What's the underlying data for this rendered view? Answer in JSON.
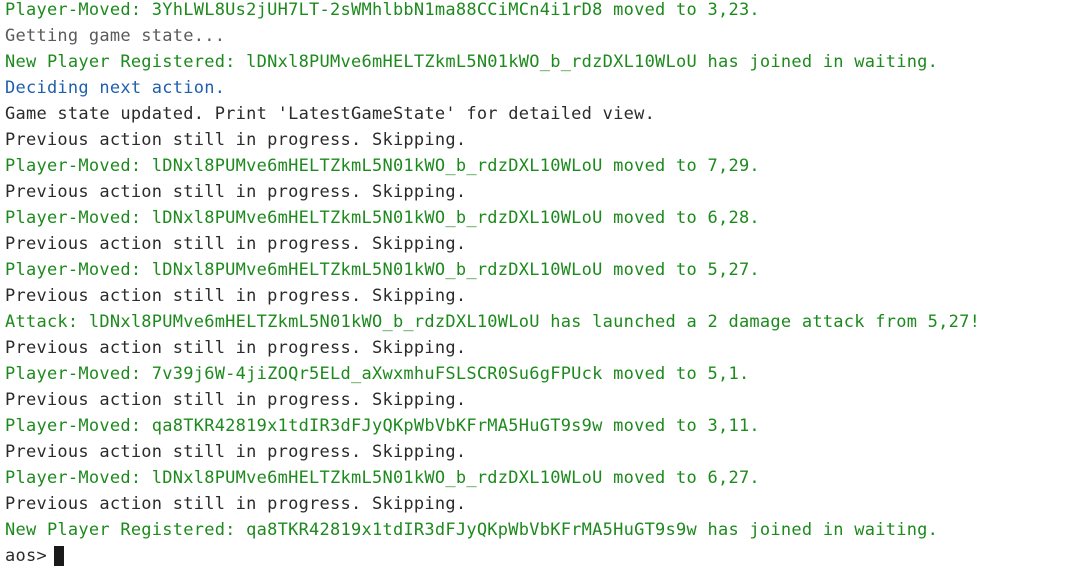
{
  "terminal": {
    "lines": [
      {
        "text": "Player-Moved: 3YhLWL8Us2jUH7LT-2sWMhlbbN1ma88CCiMCn4i1rD8 moved to 3,23.",
        "color": "#1d8a1d"
      },
      {
        "text": "Getting game state...",
        "color": "#5a5a5a"
      },
      {
        "text": "New Player Registered: lDNxl8PUMve6mHELTZkmL5N01kWO_b_rdzDXL10WLoU has joined in waiting.",
        "color": "#1d8a1d"
      },
      {
        "text": "Deciding next action.",
        "color": "#1f5fae"
      },
      {
        "text": "Game state updated. Print 'LatestGameState' for detailed view.",
        "color": "#2b2b2b"
      },
      {
        "text": "Previous action still in progress. Skipping.",
        "color": "#2b2b2b"
      },
      {
        "text": "Player-Moved: lDNxl8PUMve6mHELTZkmL5N01kWO_b_rdzDXL10WLoU moved to 7,29.",
        "color": "#1d8a1d"
      },
      {
        "text": "Previous action still in progress. Skipping.",
        "color": "#2b2b2b"
      },
      {
        "text": "Player-Moved: lDNxl8PUMve6mHELTZkmL5N01kWO_b_rdzDXL10WLoU moved to 6,28.",
        "color": "#1d8a1d"
      },
      {
        "text": "Previous action still in progress. Skipping.",
        "color": "#2b2b2b"
      },
      {
        "text": "Player-Moved: lDNxl8PUMve6mHELTZkmL5N01kWO_b_rdzDXL10WLoU moved to 5,27.",
        "color": "#1d8a1d"
      },
      {
        "text": "Previous action still in progress. Skipping.",
        "color": "#2b2b2b"
      },
      {
        "text": "Attack: lDNxl8PUMve6mHELTZkmL5N01kWO_b_rdzDXL10WLoU has launched a 2 damage attack from 5,27!",
        "color": "#1d8a1d"
      },
      {
        "text": "Previous action still in progress. Skipping.",
        "color": "#2b2b2b"
      },
      {
        "text": "Player-Moved: 7v39j6W-4jiZOQr5ELd_aXwxmhuFSLSCR0Su6gFPUck moved to 5,1.",
        "color": "#1d8a1d"
      },
      {
        "text": "Previous action still in progress. Skipping.",
        "color": "#2b2b2b"
      },
      {
        "text": "Player-Moved: qa8TKR42819x1tdIR3dFJyQKpWbVbKFrMA5HuGT9s9w moved to 3,11.",
        "color": "#1d8a1d"
      },
      {
        "text": "Previous action still in progress. Skipping.",
        "color": "#2b2b2b"
      },
      {
        "text": "Player-Moved: lDNxl8PUMve6mHELTZkmL5N01kWO_b_rdzDXL10WLoU moved to 6,27.",
        "color": "#1d8a1d"
      },
      {
        "text": "Previous action still in progress. Skipping.",
        "color": "#2b2b2b"
      },
      {
        "text": "New Player Registered: qa8TKR42819x1tdIR3dFJyQKpWbVbKFrMA5HuGT9s9w has joined in waiting.",
        "color": "#1d8a1d"
      }
    ],
    "prompt": "aos>"
  }
}
